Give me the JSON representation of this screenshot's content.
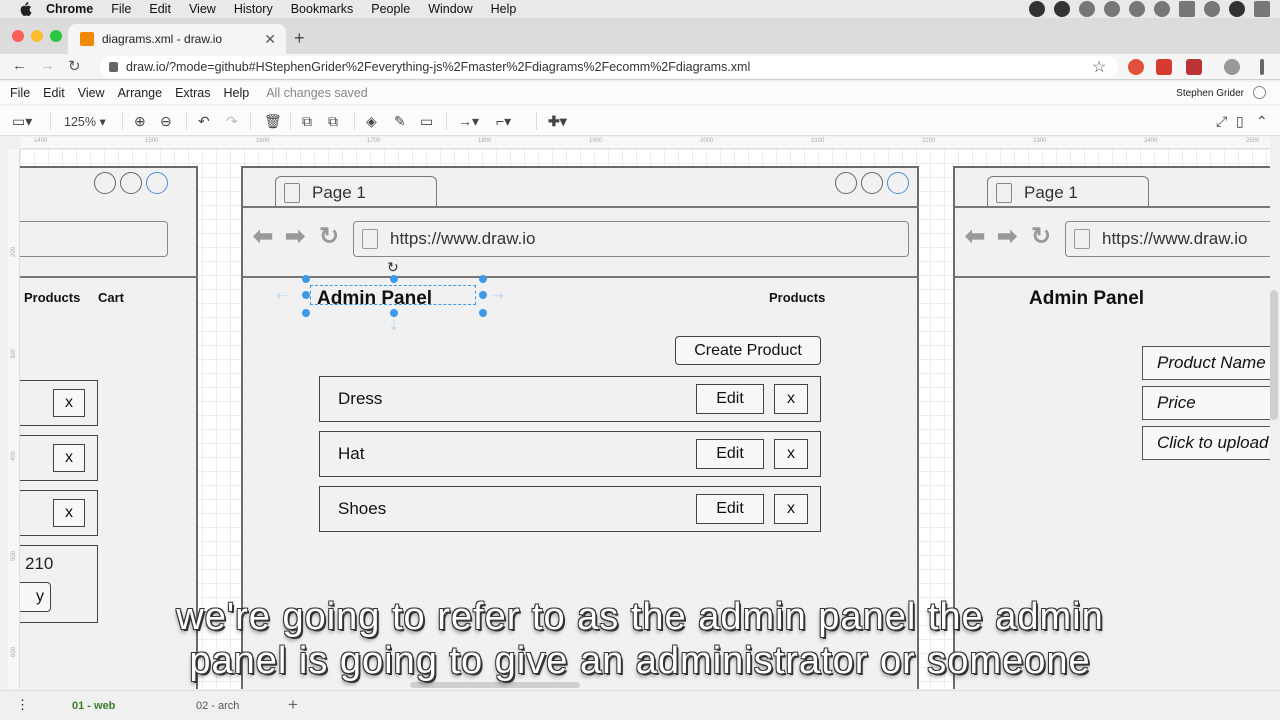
{
  "macos_menu": {
    "app": "Chrome",
    "items": [
      "File",
      "Edit",
      "View",
      "History",
      "Bookmarks",
      "People",
      "Window",
      "Help"
    ]
  },
  "browser": {
    "tab_title": "diagrams.xml - draw.io",
    "url": "draw.io/?mode=github#HStephenGrider%2Feverything-js%2Fmaster%2Fdiagrams%2Fecomm%2Fdiagrams.xml"
  },
  "drawio": {
    "menu": [
      "File",
      "Edit",
      "View",
      "Arrange",
      "Extras",
      "Help"
    ],
    "save_status": "All changes saved",
    "user": "Stephen Grider",
    "zoom": "125%",
    "ruler_ticks": [
      "1400",
      "1500",
      "1600",
      "1700",
      "1800",
      "1900",
      "2000",
      "2100",
      "2200",
      "2300",
      "2400",
      "2500"
    ],
    "ruler_left_ticks": [
      "200",
      "300",
      "400",
      "500",
      "600"
    ],
    "page_tabs": [
      "01 - web",
      "02 - arch"
    ]
  },
  "mockups": {
    "left": {
      "nav": [
        "Products",
        "Cart"
      ],
      "x_buttons": [
        "x",
        "x",
        "x"
      ],
      "value": "210",
      "button_fragment": "y"
    },
    "center": {
      "tab": "Page 1",
      "url": "https://www.draw.io",
      "heading": "Admin Panel",
      "nav": "Products",
      "create_button": "Create Product",
      "rows": [
        {
          "name": "Dress",
          "edit": "Edit",
          "x": "x"
        },
        {
          "name": "Hat",
          "edit": "Edit",
          "x": "x"
        },
        {
          "name": "Shoes",
          "edit": "Edit",
          "x": "x"
        }
      ]
    },
    "right": {
      "tab": "Page 1",
      "url": "https://www.draw.io",
      "heading": "Admin Panel",
      "fields": [
        "Product Name",
        "Price",
        "Click to upload"
      ]
    }
  },
  "captions": [
    "we're going to refer to as the admin panel the admin",
    "panel is going to give an administrator or someone"
  ],
  "colors": {
    "accent": "#3d9ae8",
    "page_tab_active": "#3a7b28",
    "drawio_favicon": "#f08705"
  }
}
